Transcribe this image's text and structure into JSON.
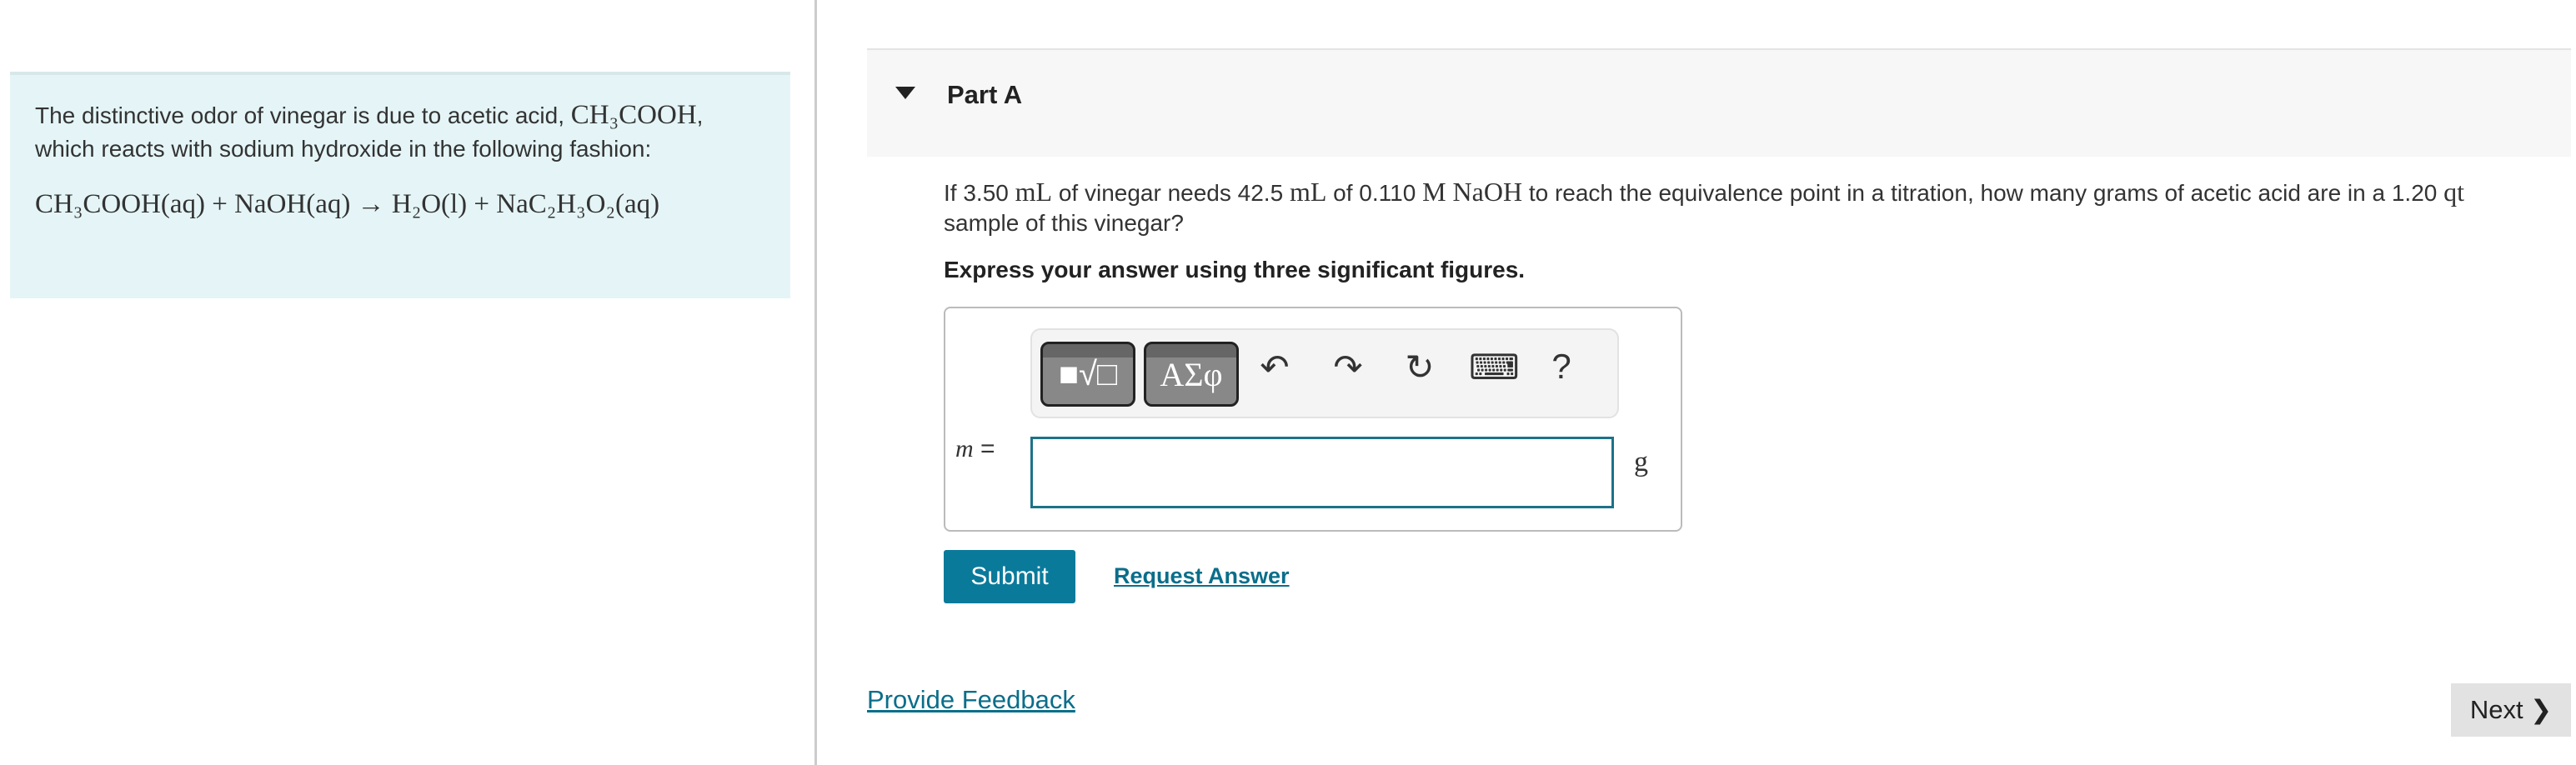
{
  "intro": {
    "text1": "The distinctive odor of vinegar is due to acetic acid, ",
    "formula": "CH₃COOH",
    "text2": ", which reacts with sodium hydroxide in the following fashion:",
    "equation": "CH₃COOH(aq) + NaOH(aq) → H₂O(l) + NaC₂H₃O₂(aq)"
  },
  "part": {
    "label": "Part A"
  },
  "question": {
    "p1": "If 3.50 ",
    "u1": "mL",
    "p2": " of vinegar needs 42.5 ",
    "u2": "mL",
    "p3": " of 0.110 ",
    "u3": "M NaOH",
    "p4": " to reach the equivalence point in a titration, how many grams of acetic acid are in a 1.20 ",
    "u4": "qt",
    "p5": " sample of this vinegar?"
  },
  "instruction": "Express your answer using three significant figures.",
  "toolbar": {
    "templates": "■√□",
    "greek": "ΑΣφ",
    "undo": "↶",
    "redo": "↷",
    "reset": "↻",
    "keyboard": "⌨",
    "help": "?"
  },
  "answer": {
    "variable": "m",
    "equals": "=",
    "value": "",
    "unit": "g"
  },
  "buttons": {
    "submit": "Submit",
    "request": "Request Answer",
    "feedback": "Provide Feedback",
    "next": "Next ❯"
  }
}
